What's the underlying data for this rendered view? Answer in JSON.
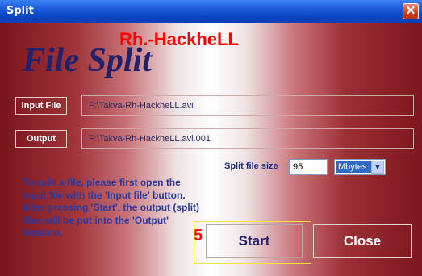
{
  "window": {
    "title": "Split",
    "close_glyph": "✕"
  },
  "brand": "Rh.-HackheLL",
  "app_title": "File Split",
  "input": {
    "label": "Input File",
    "path": "F:\\Takva-Rh-HackheLL.avi"
  },
  "output": {
    "label": "Output",
    "path": "F:\\Takva-Rh-HackheLL.avi.001"
  },
  "split_size": {
    "label": "Split file size",
    "value": "95",
    "unit": "Mbytes"
  },
  "instructions": "To split a file, please first open the input file with the 'Input file' button. After pressing 'Start', the output (split) files will be put into the 'Output' location.",
  "step_number": "5",
  "buttons": {
    "start": "Start",
    "close": "Close"
  },
  "colors": {
    "accent_red": "#ff0000",
    "title_blue": "#22226a",
    "frame_red": "#8e1b22"
  },
  "icons": {
    "dropdown": "chevron-down-icon",
    "close": "close-icon"
  }
}
